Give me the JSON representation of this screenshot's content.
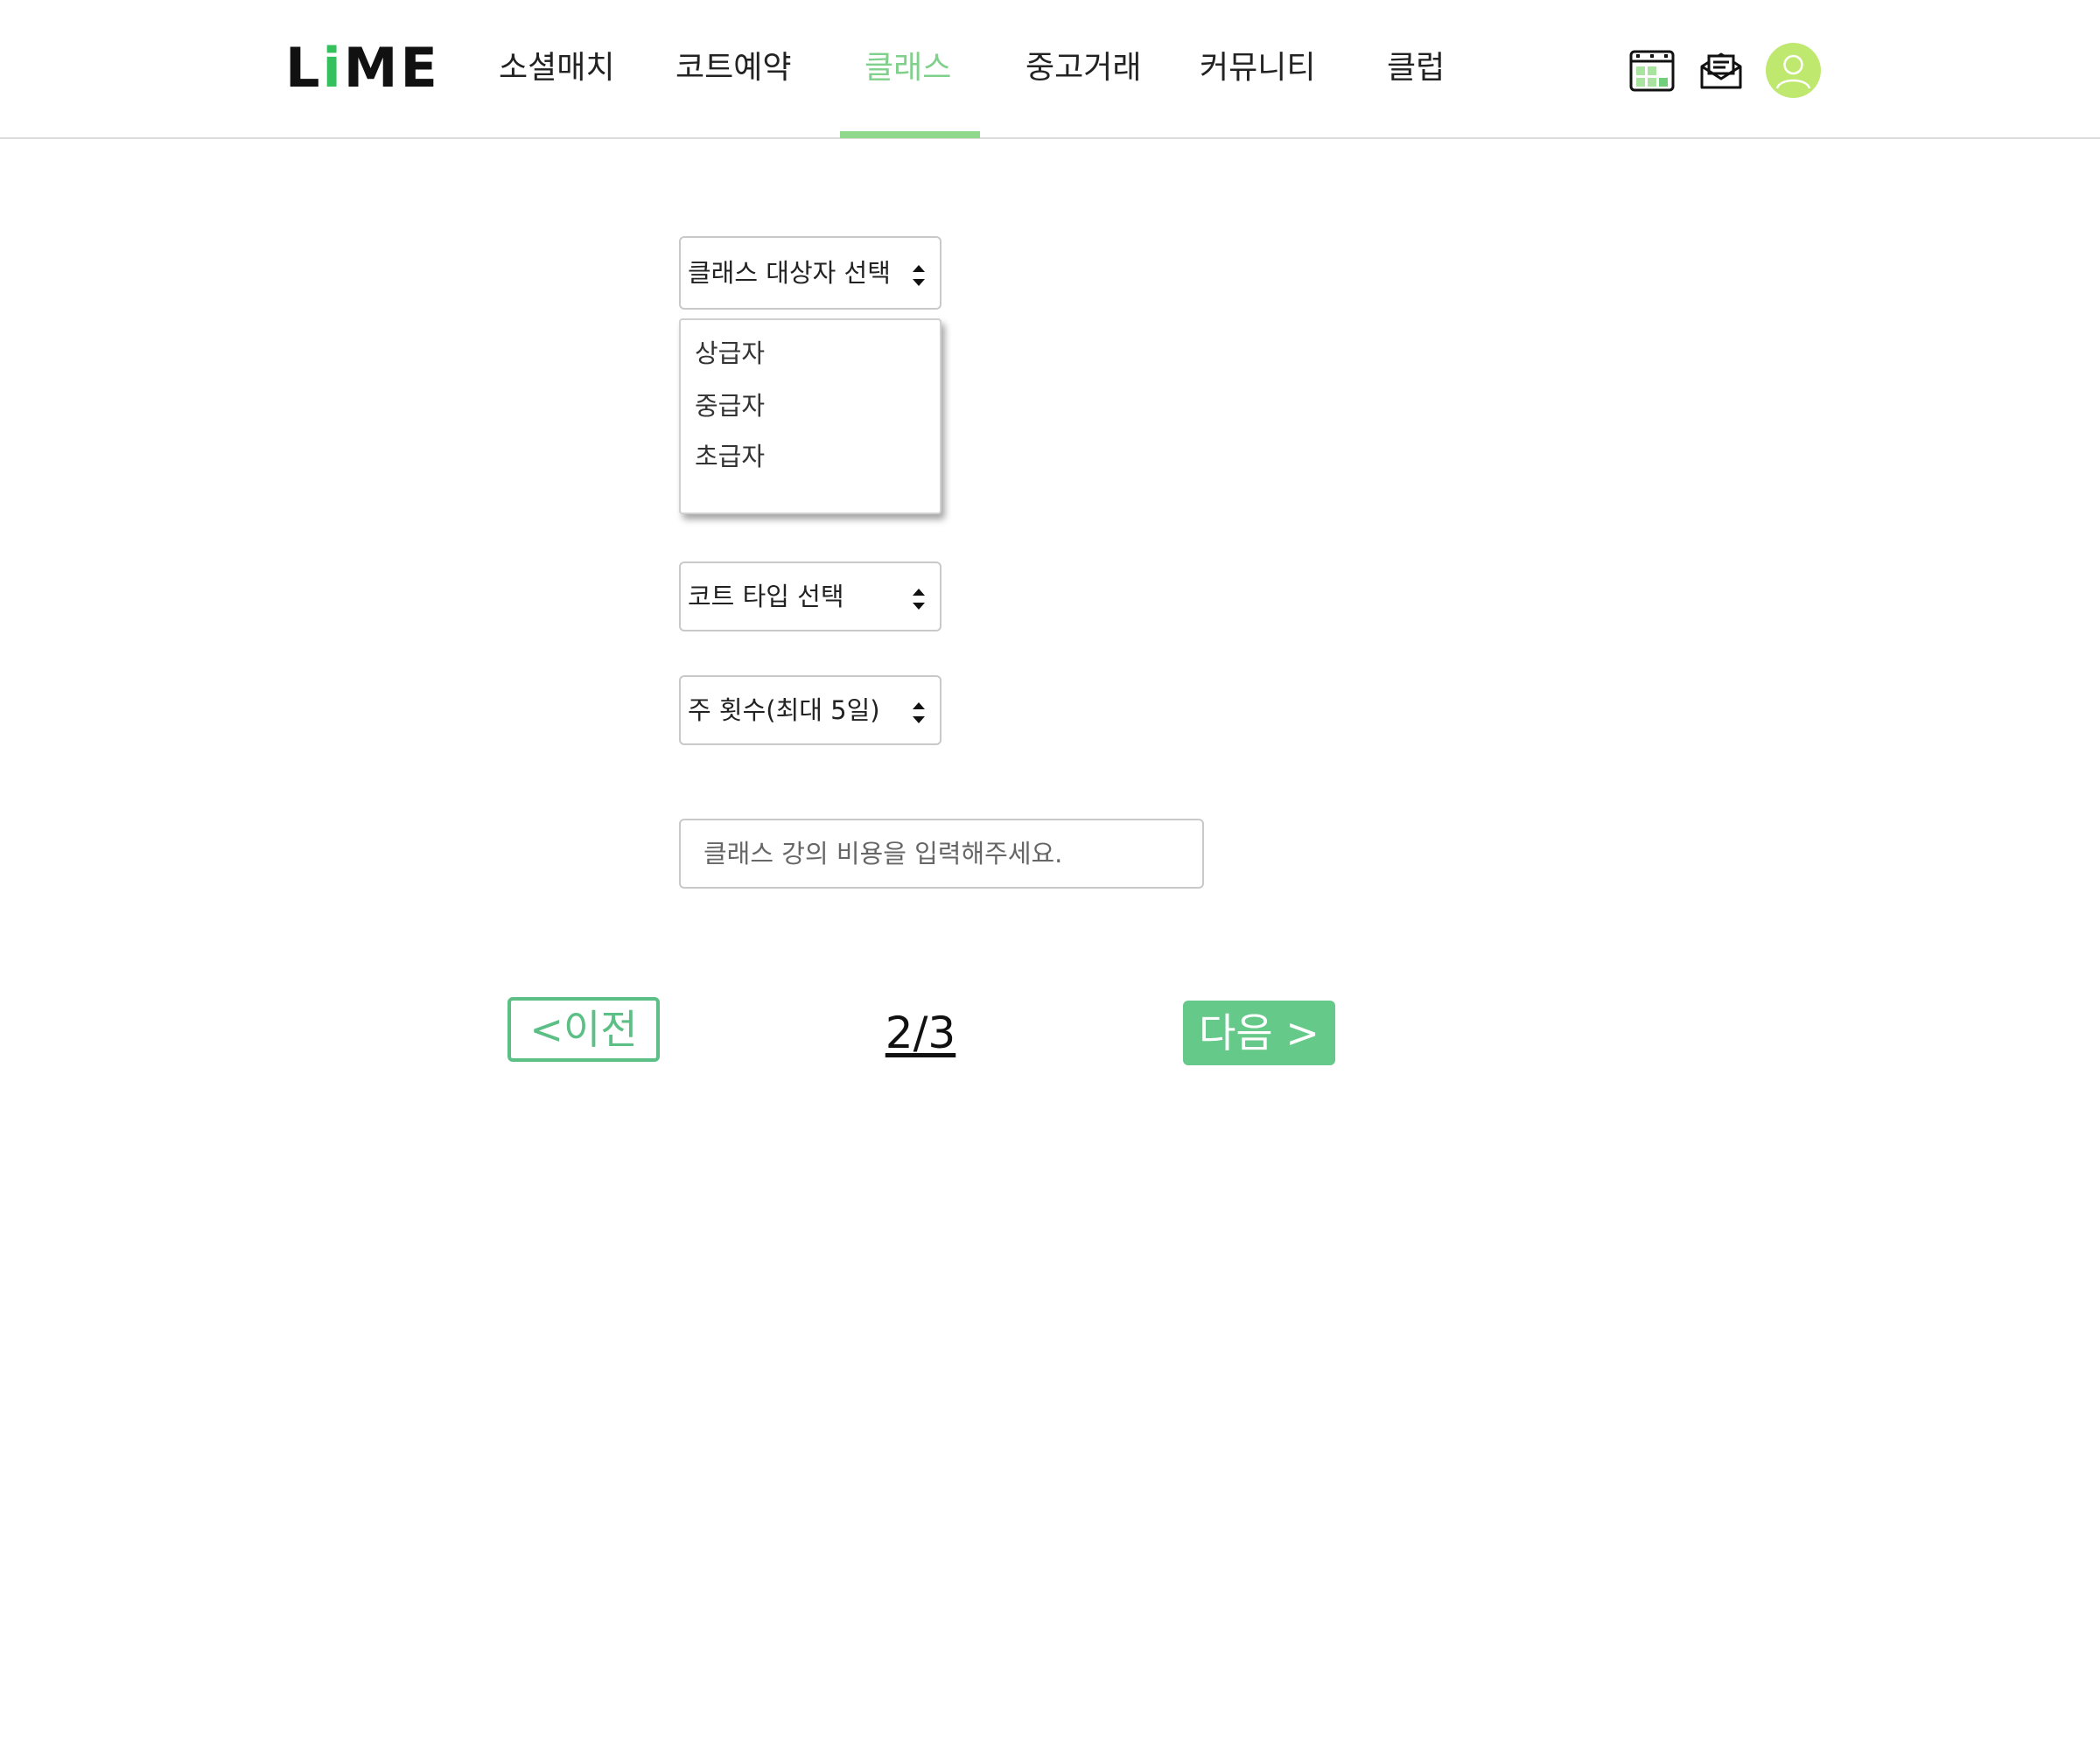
{
  "header": {
    "logo": {
      "prefix": "L",
      "highlight": "i",
      "suffix": "ME"
    },
    "nav": [
      {
        "label": "소셜매치",
        "active": false
      },
      {
        "label": "코트예약",
        "active": false
      },
      {
        "label": "클래스",
        "active": true
      },
      {
        "label": "중고거래",
        "active": false
      },
      {
        "label": "커뮤니티",
        "active": false
      },
      {
        "label": "클럽",
        "active": false
      }
    ],
    "icons": [
      "calendar-icon",
      "mail-icon",
      "user-avatar-icon"
    ]
  },
  "form": {
    "target_select": {
      "label": "클래스 대상자 선택",
      "options": [
        "상급자",
        "중급자",
        "초급자"
      ],
      "expanded": true
    },
    "court_type_select": {
      "label": "코트 타입 선택"
    },
    "weekly_count_select": {
      "label": "주 횟수(최대 5일)"
    },
    "fee_input": {
      "value": "",
      "placeholder": "클래스 강의 비용을 입력해주세요."
    }
  },
  "pager": {
    "prev_label": "<이전",
    "count": "2/3",
    "next_label": "다음 >"
  },
  "colors": {
    "accent_green": "#65c98a",
    "nav_active": "#7fd08a",
    "underline": "#8fd98c",
    "avatar_bg": "#bfe86f",
    "logo_i": "#34c05a"
  }
}
